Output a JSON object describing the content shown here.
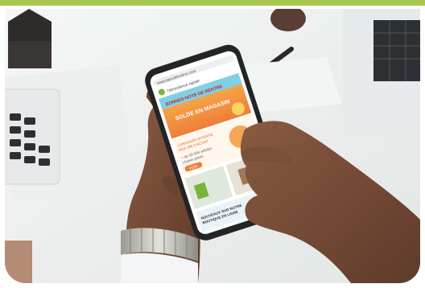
{
  "colors": {
    "accent_band": "#a7c84e",
    "desk": "#eef0ef",
    "skin": "#7b4f3a",
    "phone_frame": "#222426",
    "screen_banner": "#f29a3b",
    "screen_blue": "#7fd0e6",
    "screen_green": "#7ab33a"
  },
  "phone_screen": {
    "url_text": "www.lamultitudine.com",
    "brand_text": "l'abondance rapide",
    "banner_line1": "BONNES-NOTE DE RENTRE",
    "banner_line2": "SOLDE EN MAGASIN",
    "promo_line1": "LIVRAISON OFFERTE",
    "promo_line2": "DES 39€ D'ACHAT",
    "promo_line3": "+ de 30 000 articles",
    "promo_line4": "choisis parmi",
    "cta_label": "VOIR",
    "footer_line1": "NOUVEAUX SUR NOTRE",
    "footer_line2": "BOUTIQUE EN LIGNE"
  },
  "icons": [
    "watch-icon",
    "phone-icon",
    "keyboard-icon",
    "pen-icon",
    "house-figurine-icon"
  ]
}
